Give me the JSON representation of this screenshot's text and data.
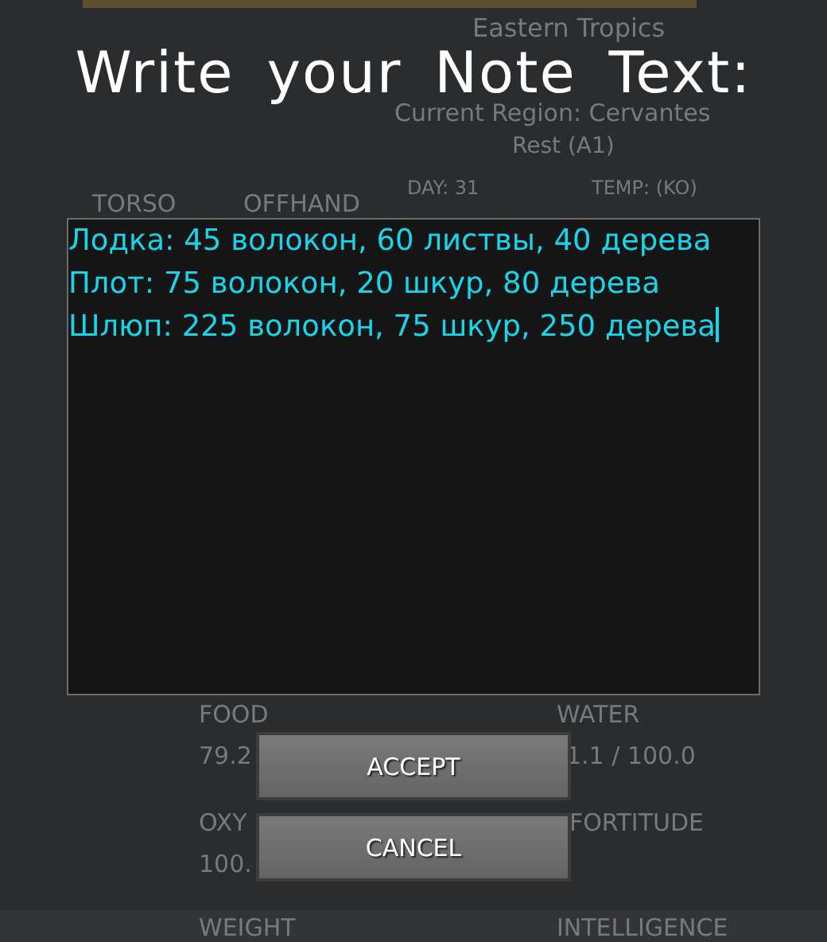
{
  "background": {
    "labels": [
      {
        "text": "Eastern Tropics"
      },
      {
        "text": "Current Region: Cervantes"
      },
      {
        "text": "Rest (A1)"
      },
      {
        "text": "DAY: 31"
      },
      {
        "text": "TEMP: (KO)"
      },
      {
        "text": "TORSO"
      },
      {
        "text": "OFFHAND"
      },
      {
        "text": "FOOD"
      },
      {
        "text": "79.2"
      },
      {
        "text": "WATER"
      },
      {
        "text": "1.1 / 100.0"
      },
      {
        "text": "OXY"
      },
      {
        "text": "100."
      },
      {
        "text": "FORTITUDE"
      },
      {
        "text": "WEIGHT"
      },
      {
        "text": "INTELLIGENCE"
      }
    ]
  },
  "dialog": {
    "title": "Write your Note Text:",
    "note": {
      "lines": [
        "Лодка: 45 волокон, 60 листвы, 40 дерева",
        "Плот: 75 волокон, 20 шкур, 80 дерева",
        "Шлюп: 225 волокон, 75 шкур, 250 дерева"
      ]
    },
    "buttons": [
      {
        "label": "ACCEPT"
      },
      {
        "label": "CANCEL"
      }
    ]
  }
}
